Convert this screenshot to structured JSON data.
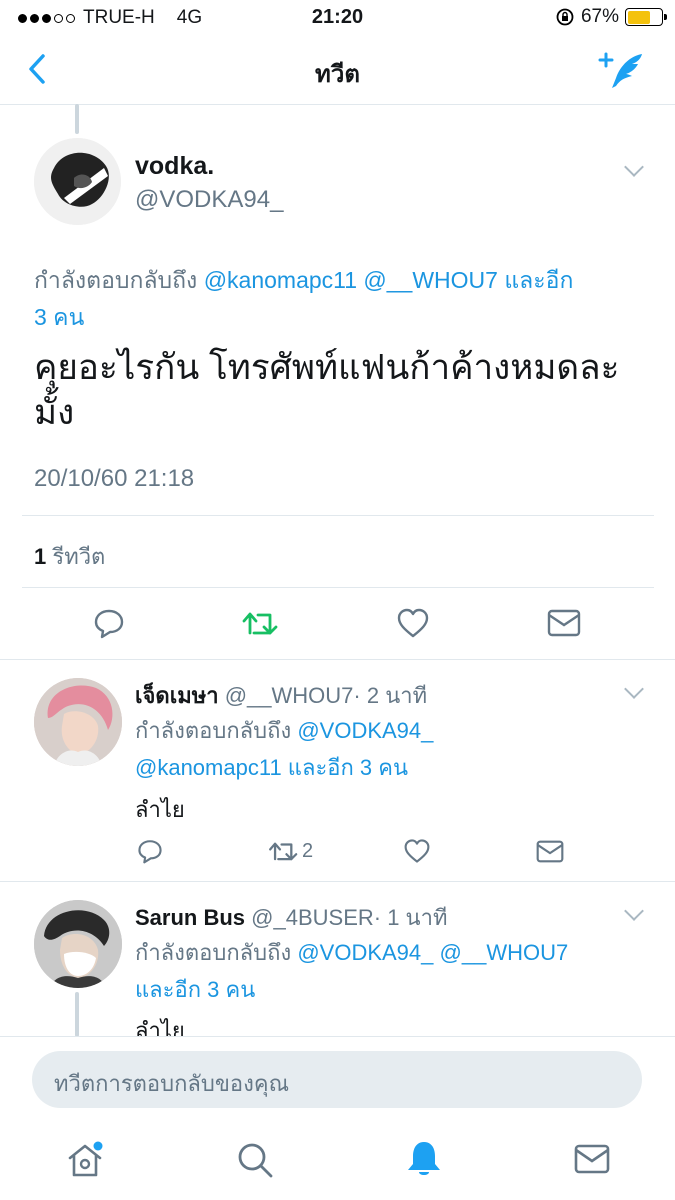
{
  "status_bar": {
    "carrier": "TRUE-H",
    "network": "4G",
    "time": "21:20",
    "battery": "67%",
    "battery_level": 0.67,
    "battery_color": "#f4c20d"
  },
  "nav": {
    "title": "ทวีต",
    "back_icon": "chevron-left-icon",
    "compose_icon": "compose-tweet-icon"
  },
  "main_tweet": {
    "name": "vodka.",
    "handle": "@VODKA94_",
    "reply_prefix": "กำลังตอบกลับถึง",
    "reply_handles": "@kanomapc11 @__WHOU7",
    "reply_more": "และอีก",
    "reply_more_line2": "3 คน",
    "text_line1": "คุยอะไรกัน โทรศัพท์แฟนก้าค้างหมดละ",
    "text_line2": "มั้ง",
    "timestamp": "20/10/60 21:18",
    "retweet_count": "1",
    "retweet_label": "รีทวีต",
    "retweet_active_color": "#17bf63"
  },
  "replies": [
    {
      "name": "เจ็ดเมษา",
      "handle": "@__WHOU7",
      "time": "· 2 นาที",
      "reply_line1": "กำลังตอบกลับถึง @VODKA94_",
      "reply_line2": "@kanomapc11 และอีก 3 คน",
      "text": "ลำไย",
      "retweets": "2"
    },
    {
      "name": "Sarun Bus",
      "handle": "@_4BUSER",
      "time": "· 1 นาที",
      "reply_line1": "กำลังตอบกลับถึง @VODKA94_ @__WHOU7",
      "reply_line2": "และอีก 3 คน",
      "text": "ลำไย"
    }
  ],
  "composer": {
    "placeholder": "ทวีตการตอบกลับของคุณ"
  },
  "tabs": {
    "items": [
      "home-icon",
      "search-icon",
      "notifications-icon",
      "messages-icon"
    ],
    "active": "notifications-icon",
    "accent": "#1da1f2"
  }
}
